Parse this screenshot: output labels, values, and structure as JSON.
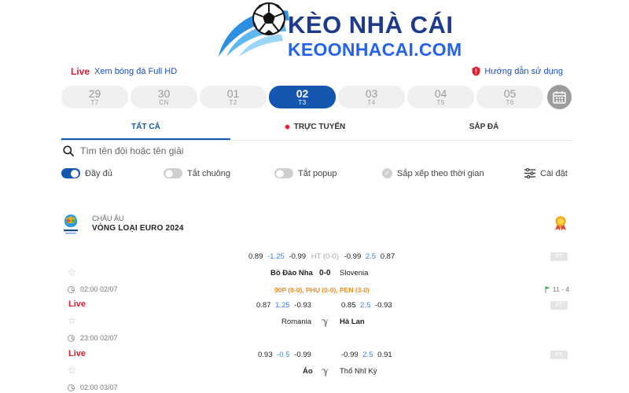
{
  "logo": {
    "line1": "KÈO NHÀ CÁI",
    "line2": "KEOONHACAI.COM",
    "colors": {
      "primary": "#1e3a8a",
      "secondary": "#2563eb",
      "swoosh": "#38bdf8"
    }
  },
  "top_bar": {
    "live_label": "Live",
    "live_text": "Xem bóng đá Full HD",
    "guide_text": "Hướng dẫn sử dụng",
    "guide_icon": "info-alert-icon"
  },
  "dates": [
    {
      "day": "29",
      "weekday": "T7"
    },
    {
      "day": "30",
      "weekday": "CN"
    },
    {
      "day": "01",
      "weekday": "T2"
    },
    {
      "day": "02",
      "weekday": "T3",
      "active": true
    },
    {
      "day": "03",
      "weekday": "T4"
    },
    {
      "day": "04",
      "weekday": "T5"
    },
    {
      "day": "05",
      "weekday": "T6"
    }
  ],
  "calendar_icon": "calendar-icon",
  "tabs": [
    {
      "label": "TẤT CẢ",
      "active": true
    },
    {
      "label": "TRỰC TUYẾN"
    },
    {
      "label": "SẮP ĐÁ"
    }
  ],
  "search": {
    "placeholder": "Tìm tên đội hoặc tên giải"
  },
  "toggles": [
    {
      "label": "Đầy đủ",
      "state": "on"
    },
    {
      "label": "Tắt chuông",
      "state": "off"
    },
    {
      "label": "Tắt popup",
      "state": "off"
    },
    {
      "label": "Sắp xếp theo thời gian",
      "state": "checked"
    },
    {
      "label": "Cài đặt"
    }
  ],
  "league": {
    "region": "CHÂU ÂU",
    "name": "VÒNG LOẠI EURO 2024",
    "logo_icon": "euro-2024-logo-icon",
    "badge_icon": "award-badge-icon"
  },
  "matches": [
    {
      "live": "",
      "time": "02:00 02/07",
      "odds_left": [
        "0.89",
        "-1.25",
        "-0.99"
      ],
      "half_time": "HT (0-0)",
      "odds_right": [
        "-0.99",
        "2.5",
        "0.87"
      ],
      "home": "Bồ Đào Nha",
      "score": "0-0",
      "away": "Slovenia",
      "extra": "90P (0-0), PHỤ (0-0), PEN (3-0)",
      "corners": "11 - 4",
      "status": "FT"
    },
    {
      "live": "Live",
      "time": "23:00 02/07",
      "odds_left": [
        "0.87",
        "1.25",
        "-0.93"
      ],
      "odds_right": [
        "0.85",
        "2.5",
        "-0.93"
      ],
      "home": "Romania",
      "away": "Hà Lan",
      "status": "FT"
    },
    {
      "live": "Live",
      "time": "02:00 03/07",
      "odds_left": [
        "0.93",
        "-0.5",
        "-0.99"
      ],
      "odds_right": [
        "-0.99",
        "2.5",
        "0.91"
      ],
      "home": "Áo",
      "away": "Thổ Nhĩ Kỳ",
      "status": "FT"
    }
  ]
}
